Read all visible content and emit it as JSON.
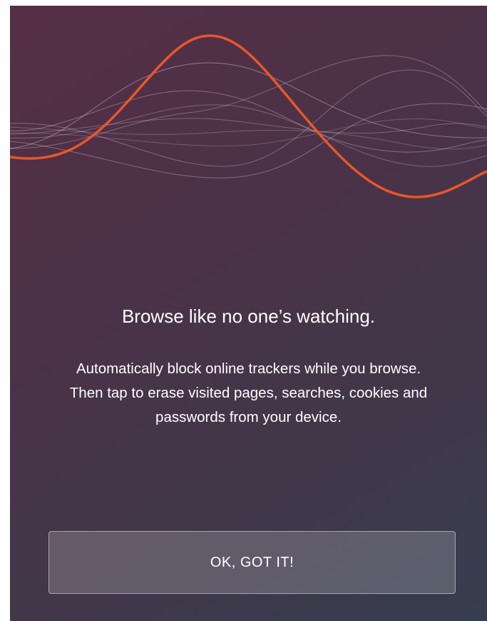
{
  "onboarding": {
    "headline": "Browse like no one’s watching.",
    "description": "Automatically block online trackers while you browse. Then tap to erase visited pages, searches, cookies and passwords from your device.",
    "confirm_label": "OK, GOT IT!"
  },
  "colors": {
    "background_top": "#552f45",
    "background_bottom": "#363e4f",
    "accent_wave": "#e8562b",
    "text": "#ffffff"
  },
  "icons": [
    "sound-wave-illustration"
  ]
}
